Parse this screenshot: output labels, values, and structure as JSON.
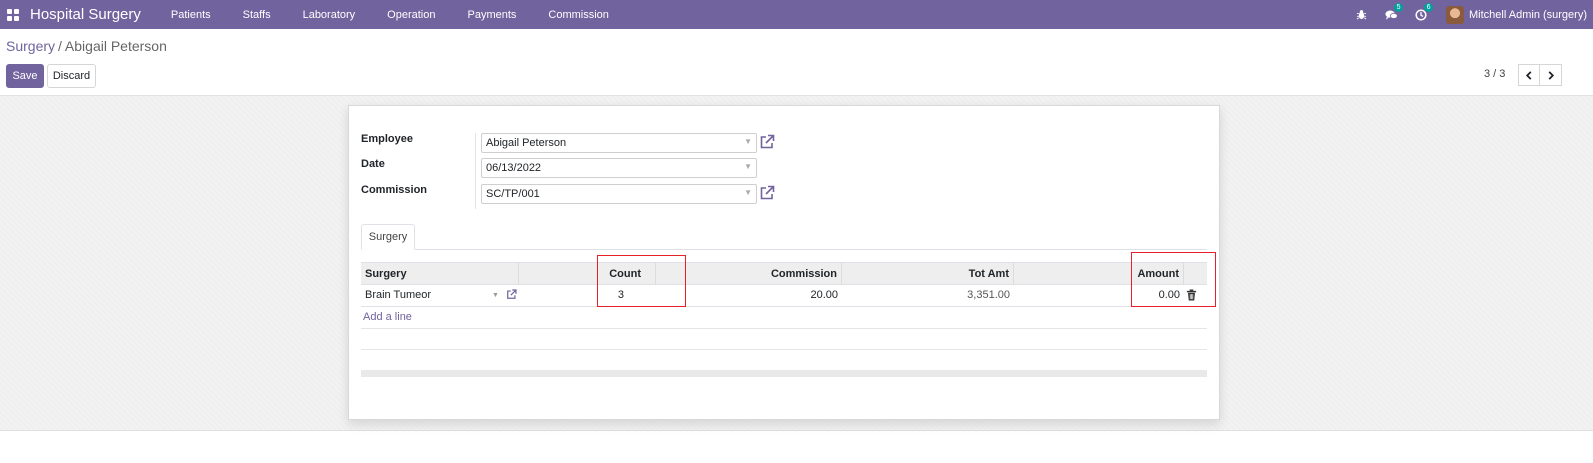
{
  "navbar": {
    "brand": "Hospital Surgery",
    "menu": [
      {
        "label": "Patients"
      },
      {
        "label": "Staffs"
      },
      {
        "label": "Laboratory"
      },
      {
        "label": "Operation"
      },
      {
        "label": "Payments"
      },
      {
        "label": "Commission"
      }
    ],
    "systray": {
      "debug_icon": "bug-icon",
      "messages_icon": "chat-icon",
      "messages_count": "5",
      "activities_icon": "clock-icon",
      "activities_count": "6",
      "user_name": "Mitchell Admin (surgery)"
    },
    "colors": {
      "navbar_bg": "#71639e",
      "badge_bg": "#00a09d"
    }
  },
  "control_panel": {
    "breadcrumb": {
      "parent": "Surgery",
      "separator": "/",
      "current": "Abigail Peterson"
    },
    "save_label": "Save",
    "discard_label": "Discard",
    "pager": {
      "value": "3 / 3"
    }
  },
  "form": {
    "employee": {
      "label": "Employee",
      "value": "Abigail Peterson"
    },
    "date": {
      "label": "Date",
      "value": "06/13/2022"
    },
    "commission": {
      "label": "Commission",
      "value": "SC/TP/001"
    },
    "tabs": [
      {
        "label": "Surgery",
        "active": true
      }
    ],
    "table": {
      "headers": {
        "surgery": "Surgery",
        "count": "Count",
        "commission": "Commission",
        "tot_amt": "Tot Amt",
        "amount": "Amount"
      },
      "rows": [
        {
          "surgery": "Brain Tumeor",
          "count": "3",
          "commission": "20.00",
          "tot_amt": "3,351.00",
          "amount": "0.00"
        }
      ],
      "add_line_label": "Add a line"
    }
  },
  "annotations": {
    "highlight_color": "#e8202a",
    "highlighted_columns": [
      "Count",
      "Amount"
    ]
  }
}
